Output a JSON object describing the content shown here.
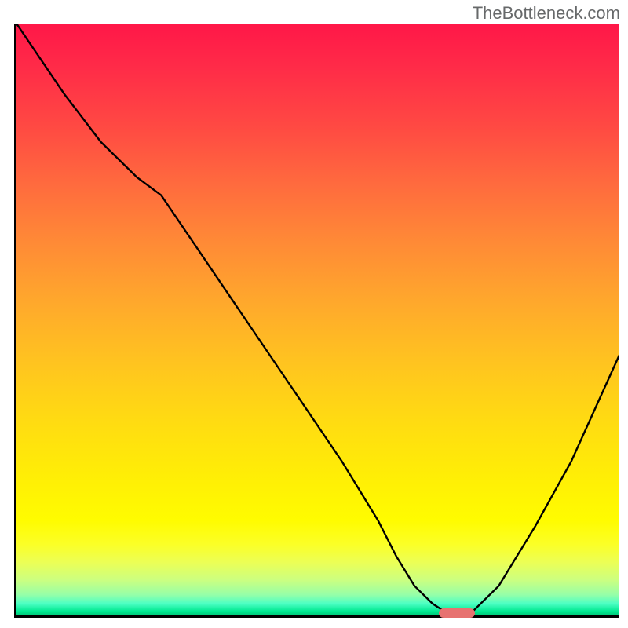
{
  "watermark": "TheBottleneck.com",
  "chart_data": {
    "type": "line",
    "title": "",
    "xlabel": "",
    "ylabel": "",
    "xlim": [
      0,
      100
    ],
    "ylim": [
      0,
      100
    ],
    "grid": false,
    "legend": false,
    "background": "rainbow-gradient-red-to-green-vertical",
    "series": [
      {
        "name": "bottleneck-curve",
        "x": [
          0,
          8,
          14,
          20,
          24,
          30,
          38,
          46,
          54,
          60,
          63,
          66,
          69,
          72,
          75,
          80,
          86,
          92,
          100
        ],
        "values": [
          100,
          88,
          80,
          74,
          71,
          62,
          50,
          38,
          26,
          16,
          10,
          5,
          2,
          0,
          0,
          5,
          15,
          26,
          44
        ]
      }
    ],
    "marker": {
      "x_start": 70,
      "x_end": 76,
      "y": 0,
      "color": "#e77270"
    }
  }
}
